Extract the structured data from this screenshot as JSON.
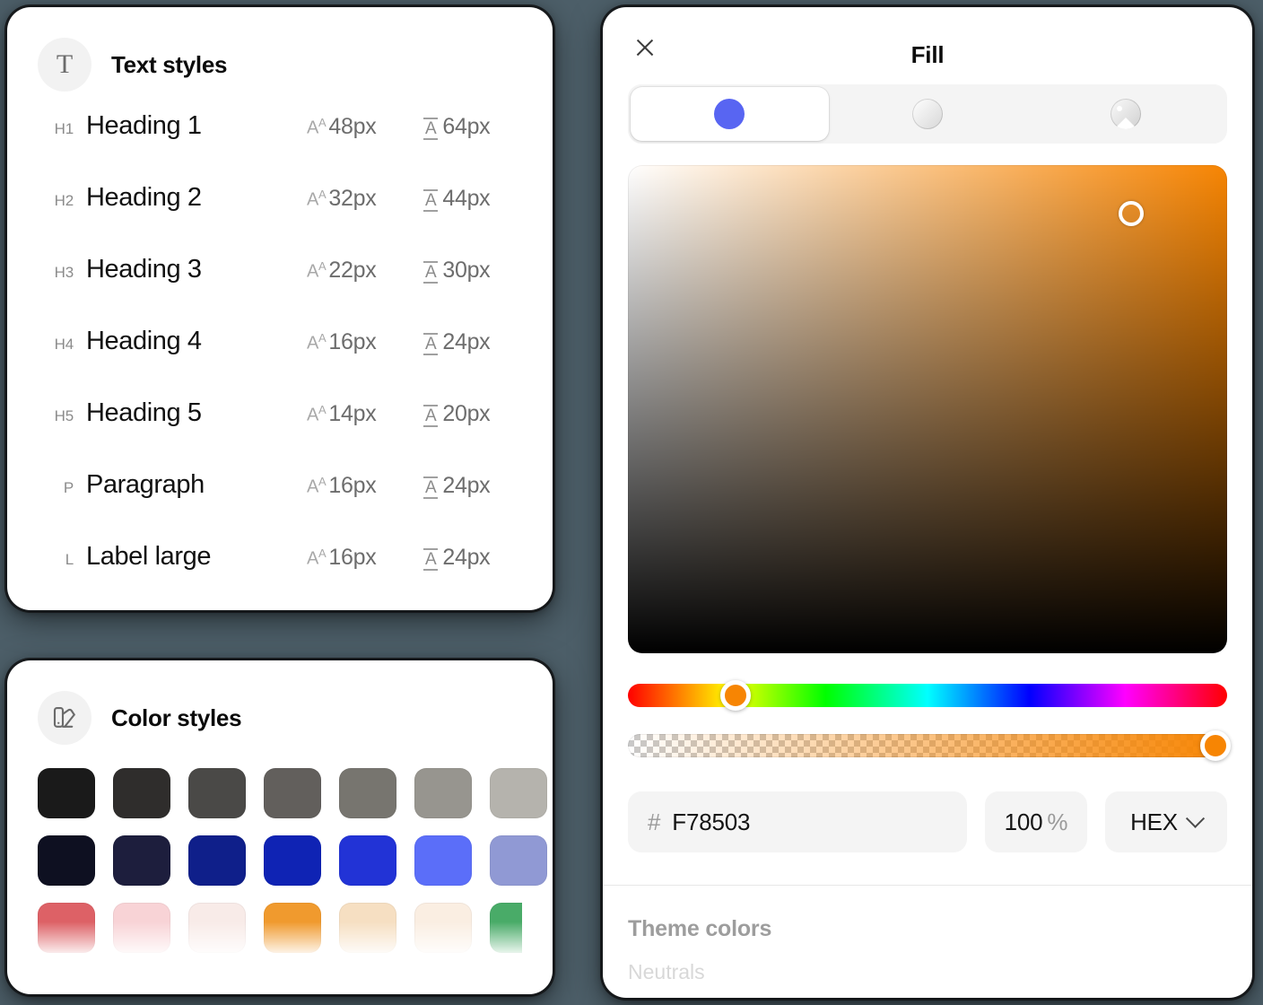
{
  "background_color": "#4d5f69",
  "text_styles_panel": {
    "icon": "text-T-icon",
    "title": "Text styles",
    "rows": [
      {
        "tag": "H1",
        "name": "Heading 1",
        "font_size": "48px",
        "line_height": "64px"
      },
      {
        "tag": "H2",
        "name": "Heading 2",
        "font_size": "32px",
        "line_height": "44px"
      },
      {
        "tag": "H3",
        "name": "Heading 3",
        "font_size": "22px",
        "line_height": "30px"
      },
      {
        "tag": "H4",
        "name": "Heading 4",
        "font_size": "16px",
        "line_height": "24px"
      },
      {
        "tag": "H5",
        "name": "Heading 5",
        "font_size": "14px",
        "line_height": "20px"
      },
      {
        "tag": "P",
        "name": "Paragraph",
        "font_size": "16px",
        "line_height": "24px"
      },
      {
        "tag": "L",
        "name": "Label large",
        "font_size": "16px",
        "line_height": "24px"
      }
    ]
  },
  "color_styles_panel": {
    "icon": "palette-swatches-icon",
    "title": "Color styles",
    "rows": [
      [
        "#1a1a1a",
        "#2f2d2c",
        "#4a4947",
        "#625f5c",
        "#77756f",
        "#97958f",
        "#b5b3ad"
      ],
      [
        "#0e1021",
        "#1d1e3d",
        "#0f1f8a",
        "#0f23b4",
        "#2233d6",
        "#5b6ef9",
        "#9099d4"
      ],
      [
        "#dd6166",
        "#f8d3d6",
        "#f8ebe8",
        "#f09a2e",
        "#f6dfc2",
        "#faeee2",
        "#49ab68"
      ]
    ]
  },
  "fill_panel": {
    "close_icon": "close-icon",
    "title": "Fill",
    "tabs": [
      {
        "id": "solid",
        "icon": "solid-color-circle-icon",
        "active": true
      },
      {
        "id": "gradient",
        "icon": "gradient-circle-icon",
        "active": false
      },
      {
        "id": "image",
        "icon": "image-circle-icon",
        "active": false
      }
    ],
    "picker": {
      "current_color": "#F78503",
      "handle_x_pct": 84,
      "handle_y_pct": 10,
      "hue_handle_pct": 18,
      "alpha_handle_pct": 98
    },
    "hex_field": {
      "prefix": "#",
      "value": "F78503"
    },
    "opacity_field": {
      "value": "100",
      "unit": "%"
    },
    "format_field": {
      "value": "HEX",
      "icon": "chevron-down-icon"
    },
    "theme_section": {
      "heading": "Theme colors",
      "subtle": "Neutrals"
    }
  }
}
